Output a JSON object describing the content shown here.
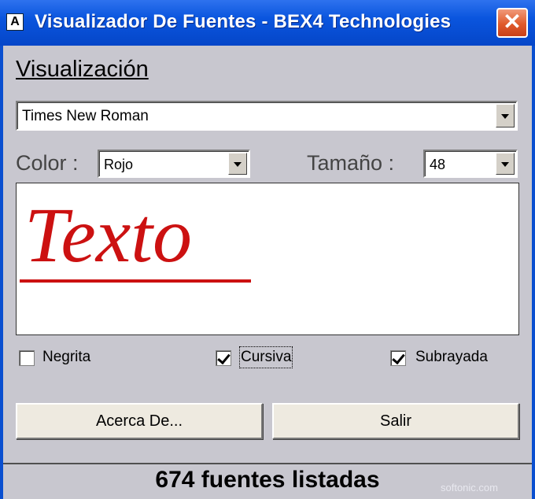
{
  "window": {
    "title": "Visualizador De Fuentes - BEX4 Technologies",
    "app_icon_glyph": "A",
    "close_glyph": "✕",
    "title_bar_color": "#0a55de"
  },
  "section": {
    "title": "Visualización"
  },
  "font_select": {
    "value": "Times New Roman"
  },
  "color_field": {
    "label": "Color :",
    "value": "Rojo"
  },
  "size_field": {
    "label": "Tamaño :",
    "value": "48"
  },
  "preview": {
    "text": "Texto",
    "color": "#cc1111",
    "italic": true,
    "underline": true
  },
  "options": {
    "bold": {
      "label": "Negrita",
      "checked": false
    },
    "italic": {
      "label": "Cursiva",
      "checked": true
    },
    "underline": {
      "label": "Subrayada",
      "checked": true
    }
  },
  "buttons": {
    "about": "Acerca De...",
    "exit": "Salir"
  },
  "status": {
    "text": "674 fuentes listadas"
  },
  "watermark": {
    "text": "softonic.com"
  }
}
